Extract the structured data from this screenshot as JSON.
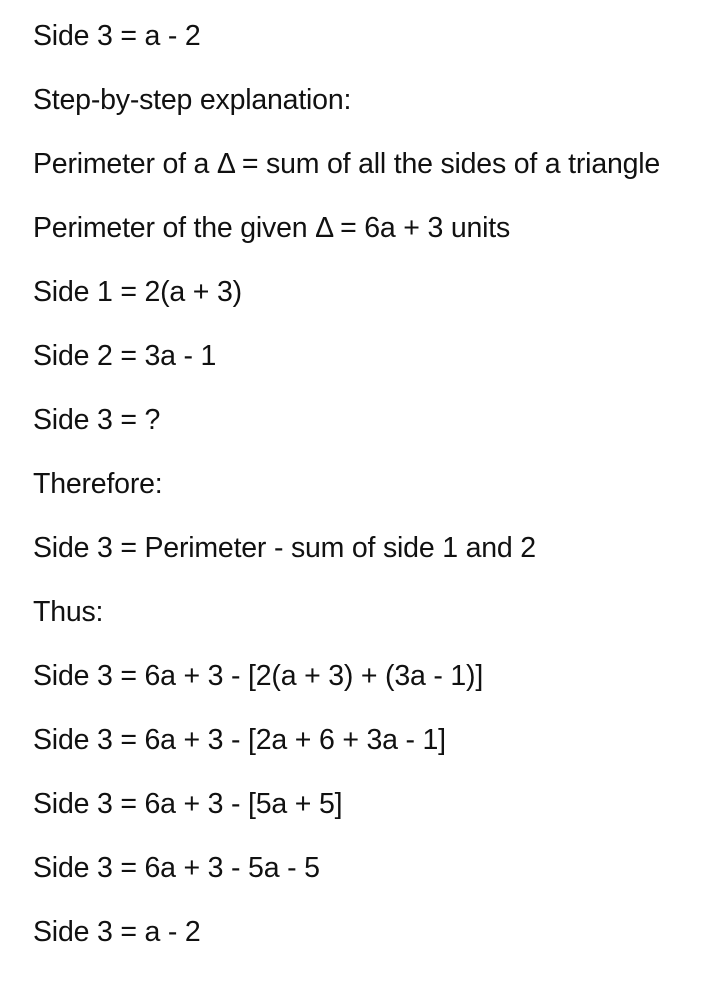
{
  "lines": [
    "Side 3 = a - 2",
    "Step-by-step explanation:",
    "Perimeter of a Δ = sum of all the sides of a triangle",
    "Perimeter of the given Δ = 6a + 3 units",
    "Side 1 = 2(a + 3)",
    "Side 2 = 3a - 1",
    "Side 3 = ?",
    "Therefore:",
    "Side 3 = Perimeter - sum of side 1 and 2",
    "Thus:",
    "Side 3 = 6a + 3 - [2(a + 3) + (3a - 1)]",
    "Side 3 = 6a + 3 - [2a + 6 + 3a - 1]",
    "Side 3 = 6a + 3 - [5a + 5]",
    "Side 3 = 6a + 3 - 5a - 5",
    "Side 3 = a - 2"
  ]
}
